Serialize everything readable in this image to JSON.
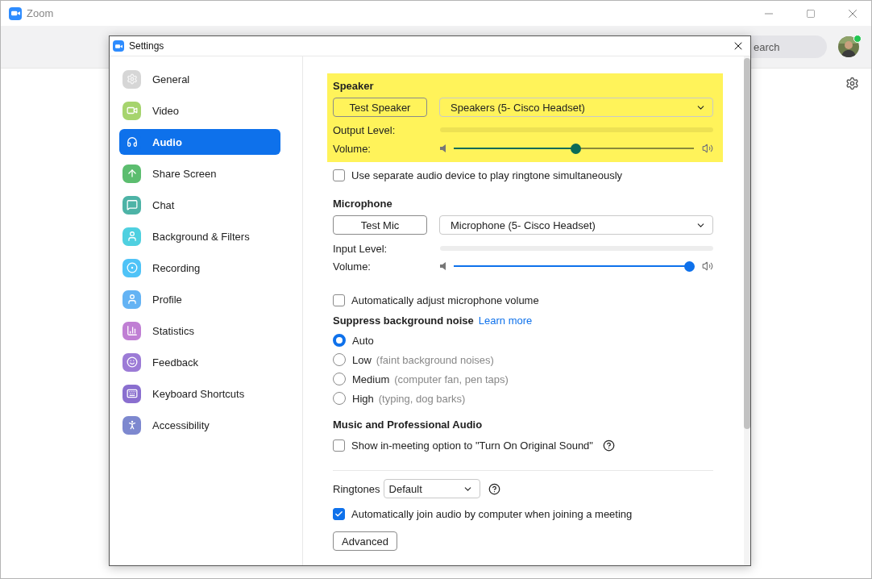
{
  "app": {
    "title": "Zoom"
  },
  "search": {
    "placeholder": "earch"
  },
  "dialog": {
    "title": "Settings"
  },
  "sidebar": {
    "items": [
      {
        "label": "General",
        "selected": false,
        "color": "#d6d6d6"
      },
      {
        "label": "Video",
        "selected": false,
        "color": "#a6d46e"
      },
      {
        "label": "Audio",
        "selected": true,
        "color": "#0e71eb"
      },
      {
        "label": "Share Screen",
        "selected": false,
        "color": "#5cbd6f"
      },
      {
        "label": "Chat",
        "selected": false,
        "color": "#4db3a6"
      },
      {
        "label": "Background & Filters",
        "selected": false,
        "color": "#4fd0e0"
      },
      {
        "label": "Recording",
        "selected": false,
        "color": "#4fc3f7"
      },
      {
        "label": "Profile",
        "selected": false,
        "color": "#64b3f4"
      },
      {
        "label": "Statistics",
        "selected": false,
        "color": "#c07fd4"
      },
      {
        "label": "Feedback",
        "selected": false,
        "color": "#9c7bd6"
      },
      {
        "label": "Keyboard Shortcuts",
        "selected": false,
        "color": "#8a6fcf"
      },
      {
        "label": "Accessibility",
        "selected": false,
        "color": "#7d88cf"
      }
    ]
  },
  "speaker": {
    "heading": "Speaker",
    "highlighted": true,
    "test_button": "Test Speaker",
    "device": "Speakers (5- Cisco Headset)",
    "level_label": "Output Level:",
    "volume_label": "Volume:",
    "volume": {
      "level": 0.51
    }
  },
  "ringtone_device": {
    "label": "Use separate audio device to play ringtone simultaneously",
    "checked": false
  },
  "microphone": {
    "heading": "Microphone",
    "highlighted": false,
    "test_button": "Test Mic",
    "device": "Microphone (5- Cisco Headset)",
    "level_label": "Input Level:",
    "volume_label": "Volume:",
    "volume": {
      "level": 0.98
    }
  },
  "auto_adjust": {
    "label": "Automatically adjust microphone volume",
    "checked": false
  },
  "noise": {
    "heading": "Suppress background noise",
    "link": "Learn more",
    "options": [
      {
        "label": "Auto",
        "selected": true
      },
      {
        "label": "Low",
        "hint": "(faint background noises)",
        "selected": false
      },
      {
        "label": "Medium",
        "hint": "(computer fan, pen taps)",
        "selected": false
      },
      {
        "label": "High",
        "hint": "(typing, dog barks)",
        "selected": false
      }
    ]
  },
  "music": {
    "heading": "Music and Professional Audio",
    "option": {
      "label": "Show in-meeting option to \"Turn On Original Sound\"",
      "checked": false
    }
  },
  "ringtones": {
    "label": "Ringtones",
    "value": "Default"
  },
  "auto_join": {
    "label": "Automatically join audio by computer when joining a meeting",
    "checked": true
  },
  "advanced_button": "Advanced"
}
